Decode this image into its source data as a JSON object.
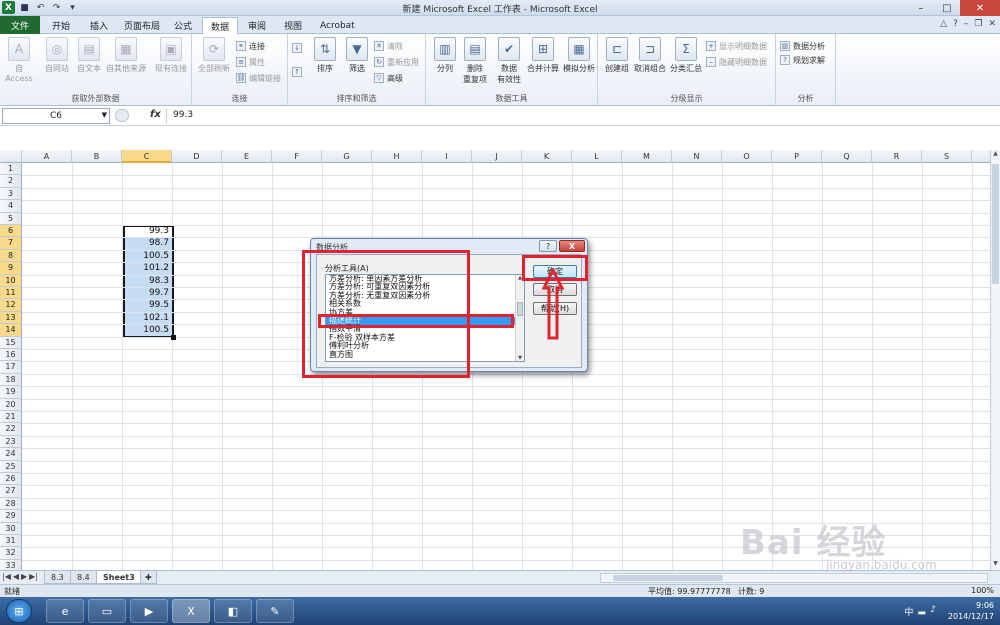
{
  "window": {
    "title": "新建 Microsoft Excel 工作表 - Microsoft Excel",
    "app_icon": "X"
  },
  "tabs": {
    "file": "文件",
    "items": [
      "开始",
      "插入",
      "页面布局",
      "公式",
      "数据",
      "审阅",
      "视图",
      "Acrobat"
    ],
    "active": "数据"
  },
  "ribbon": {
    "get_external": {
      "label": "获取外部数据",
      "buttons": [
        "自 Access",
        "自网站",
        "自文本",
        "自其他来源",
        "现有连接"
      ]
    },
    "connections": {
      "label": "连接",
      "refresh_all": "全部刷新",
      "connect": "连接",
      "properties": "属性",
      "edit_links": "编辑链接"
    },
    "sort_filter": {
      "label": "排序和筛选",
      "sort": "排序",
      "filter": "筛选",
      "clear": "清除",
      "reapply": "重新应用",
      "advanced": "高级"
    },
    "data_tools": {
      "label": "数据工具",
      "text_to_columns": "分列",
      "remove_dup_line1": "删除",
      "remove_dup_line2": "重复项",
      "validation_line1": "数据",
      "validation_line2": "有效性",
      "consolidate": "合并计算",
      "what_if": "模拟分析"
    },
    "outline": {
      "label": "分级显示",
      "group": "创建组",
      "ungroup": "取消组合",
      "subtotal": "分类汇总",
      "show_detail": "显示明细数据",
      "hide_detail": "隐藏明细数据"
    },
    "analysis": {
      "label": "分析",
      "data_analysis": "数据分析",
      "solver": "规划求解"
    }
  },
  "formula_bar": {
    "name_box": "C6",
    "fx": "fx",
    "value": "99.3"
  },
  "grid": {
    "columns": [
      "A",
      "B",
      "C",
      "D",
      "E",
      "F",
      "G",
      "H",
      "I",
      "J",
      "K",
      "L",
      "M",
      "N",
      "O",
      "P",
      "Q",
      "R",
      "S"
    ],
    "selected_column": "C",
    "row_count": 33,
    "selected_rows": [
      6,
      7,
      8,
      9,
      10,
      11,
      12,
      13,
      14
    ],
    "c_values": [
      "99.3",
      "98.7",
      "100.5",
      "101.2",
      "98.3",
      "99.7",
      "99.5",
      "102.1",
      "100.5"
    ]
  },
  "sheets": {
    "tabs": [
      "8.3",
      "8.4",
      "Sheet3"
    ],
    "active": "Sheet3"
  },
  "status": {
    "ready": "就绪",
    "average": "平均值: 99.97777778",
    "count": "计数: 9",
    "zoom": "100%"
  },
  "dialog": {
    "title": "数据分析",
    "help_btn": "?",
    "close_btn": "X",
    "list_label": "分析工具(A)",
    "items": [
      "方差分析: 单因素方差分析",
      "方差分析: 可重复双因素分析",
      "方差分析: 无重复双因素分析",
      "相关系数",
      "协方差",
      "描述统计",
      "指数平滑",
      "F-检验 双样本方差",
      "傅利叶分析",
      "直方图"
    ],
    "selected_index": 5,
    "ok": "确定",
    "cancel": "取消",
    "help": "帮助(H)"
  },
  "taskbar": {
    "time": "9:06",
    "date": "2014/12/17",
    "lang": "中"
  },
  "watermark": {
    "main": "Bai 经验",
    "sub": "jingyan.baidu.com"
  },
  "colors": {
    "annotation": "#e2222f",
    "selection_fill": "#c6dcf3",
    "header_highlight": "#f9d98a",
    "list_selected": "#3399ff"
  }
}
